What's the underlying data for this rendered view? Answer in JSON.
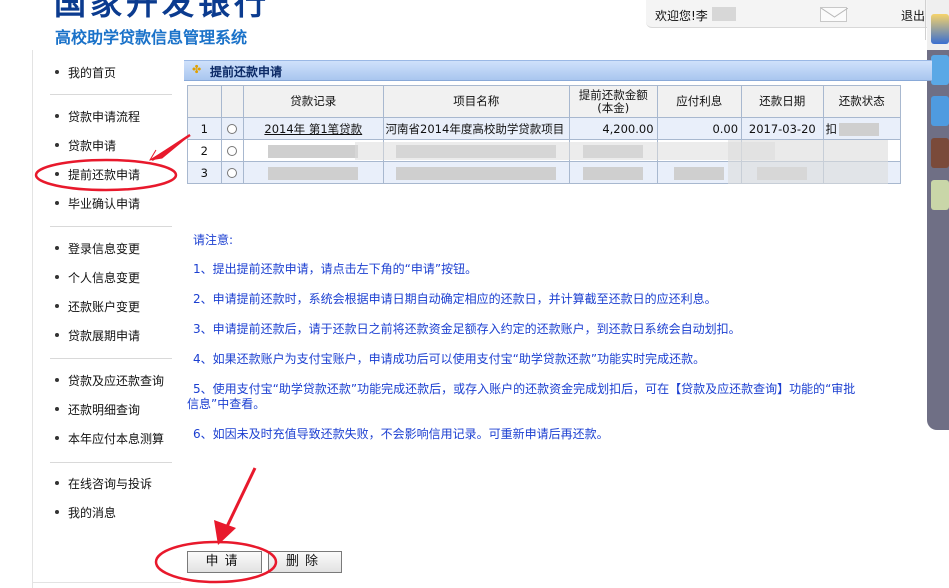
{
  "header": {
    "logo_text": "国家开发银行",
    "system_name": "高校助学贷款信息管理系统",
    "welcome": "欢迎您!李",
    "logout": "退出"
  },
  "nav": [
    {
      "label": "我的首页"
    },
    {
      "label": "贷款申请流程"
    },
    {
      "label": "贷款申请"
    },
    {
      "label": "提前还款申请"
    },
    {
      "label": "毕业确认申请"
    },
    {
      "label": "登录信息变更"
    },
    {
      "label": "个人信息变更"
    },
    {
      "label": "还款账户变更"
    },
    {
      "label": "贷款展期申请"
    },
    {
      "label": "贷款及应还款查询"
    },
    {
      "label": "还款明细查询"
    },
    {
      "label": "本年应付本息测算"
    },
    {
      "label": "在线咨询与投诉"
    },
    {
      "label": "我的消息"
    }
  ],
  "panel": {
    "title": "提前还款申请"
  },
  "table": {
    "headers": [
      "贷款记录",
      "项目名称",
      "提前还款金额(本金)",
      "应付利息",
      "还款日期",
      "还款状态"
    ],
    "header_line1": "提前还款金额",
    "header_line2": "(本金)",
    "rows": [
      {
        "index": "1",
        "record": "2014年 第1笔贷款",
        "project": "河南省2014年度高校助学贷款项目",
        "amount": "4,200.00",
        "interest": "0.00",
        "date": "2017-03-20",
        "status": "扣"
      },
      {
        "index": "2",
        "record": "",
        "project": "",
        "amount": "",
        "interest": "",
        "date": "",
        "status": ""
      },
      {
        "index": "3",
        "record": "",
        "project": "",
        "amount": "",
        "interest": "",
        "date": "",
        "status": ""
      }
    ]
  },
  "notes": {
    "heading": "请注意:",
    "items": [
      "1、提出提前还款申请，请点击左下角的“申请”按钮。",
      "2、申请提前还款时，系统会根据申请日期自动确定相应的还款日，并计算截至还款日的应还利息。",
      "3、申请提前还款后，请于还款日之前将还款资金足额存入约定的还款账户，到还款日系统会自动划扣。",
      "4、如果还款账户为支付宝账户，申请成功后可以使用支付宝“助学贷款还款”功能实时完成还款。",
      "5、使用支付宝“助学贷款还款”功能完成还款后，或存入账户的还款资金完成划扣后，可在【贷款及应还款查询】功能的“审批",
      "信息”中查看。",
      "6、如因未及时充值导致还款失败，不会影响信用记录。可重新申请后再还款。"
    ]
  },
  "buttons": {
    "apply": "申请",
    "delete": "删除"
  },
  "colors": {
    "accent": "#1a72c9",
    "note_text": "#1b3fd1",
    "annotation": "#e8192c"
  }
}
